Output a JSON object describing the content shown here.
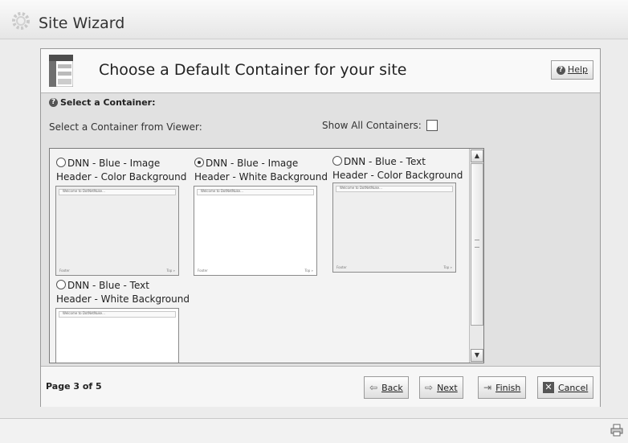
{
  "app": {
    "title": "Site Wizard"
  },
  "wizard": {
    "title": "Choose a Default Container for your site",
    "help_label": "Help",
    "section_title": "Select a Container:",
    "select_label": "Select a Container from Viewer:",
    "show_all_label": "Show All Containers:",
    "show_all_checked": false,
    "containers": [
      {
        "line1": "DNN - Blue - Image",
        "line2": "Header - Color Background",
        "selected": false,
        "background": "color"
      },
      {
        "line1": "DNN - Blue - Image",
        "line2": "Header - White Background",
        "selected": true,
        "background": "white"
      },
      {
        "line1": "DNN - Blue - Text",
        "line2": "Header - Color Background",
        "selected": false,
        "background": "color"
      },
      {
        "line1": "DNN - Blue - Text",
        "line2": "Header - White Background",
        "selected": false,
        "background": "white"
      }
    ],
    "thumb_header_text": "Welcome to DotNetNuke...",
    "thumb_footer_left": "Footer",
    "thumb_footer_right": "Top »",
    "page_indicator": "Page 3 of 5",
    "buttons": {
      "back": "Back",
      "next": "Next",
      "finish": "Finish",
      "cancel": "Cancel"
    }
  }
}
